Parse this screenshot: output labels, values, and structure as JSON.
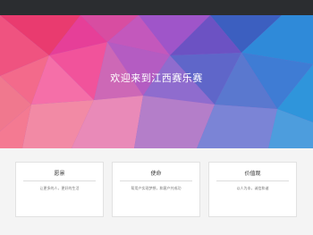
{
  "hero": {
    "title": "欢迎来到江西赛乐赛"
  },
  "cards": [
    {
      "title": "愿景",
      "text": "让更多的人，更好的生活"
    },
    {
      "title": "使命",
      "text": "帮用户实现梦想，和客户共成功"
    },
    {
      "title": "价值观",
      "text": "以人为本，诚信和谐"
    }
  ],
  "colors": {
    "nav_background": "#2b2d30",
    "hero_pink": "#f0457a",
    "hero_purple": "#8f5fd0",
    "hero_blue": "#2f7fd6",
    "card_background": "#ffffff"
  }
}
